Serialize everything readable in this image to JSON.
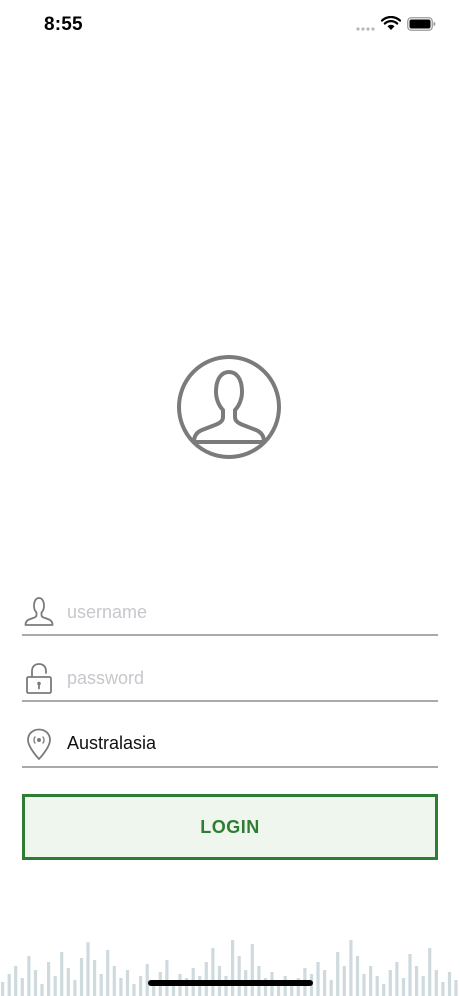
{
  "status_bar": {
    "time": "8:55"
  },
  "icons": {
    "avatar": "user-avatar-icon",
    "username": "person-icon",
    "password": "padlock-icon",
    "region": "location-pin-icon",
    "wifi": "wifi-icon",
    "battery": "battery-icon"
  },
  "form": {
    "username": {
      "value": "",
      "placeholder": "username"
    },
    "password": {
      "value": "",
      "placeholder": "password"
    },
    "region": {
      "value": "Australasia"
    },
    "login_label": "LOGIN"
  },
  "colors": {
    "accent": "#2f7d32",
    "button_bg": "#eef6ee",
    "underline": "#a9a9a9",
    "icon_gray": "#7b7b7b",
    "waveform": "#cfdade"
  }
}
